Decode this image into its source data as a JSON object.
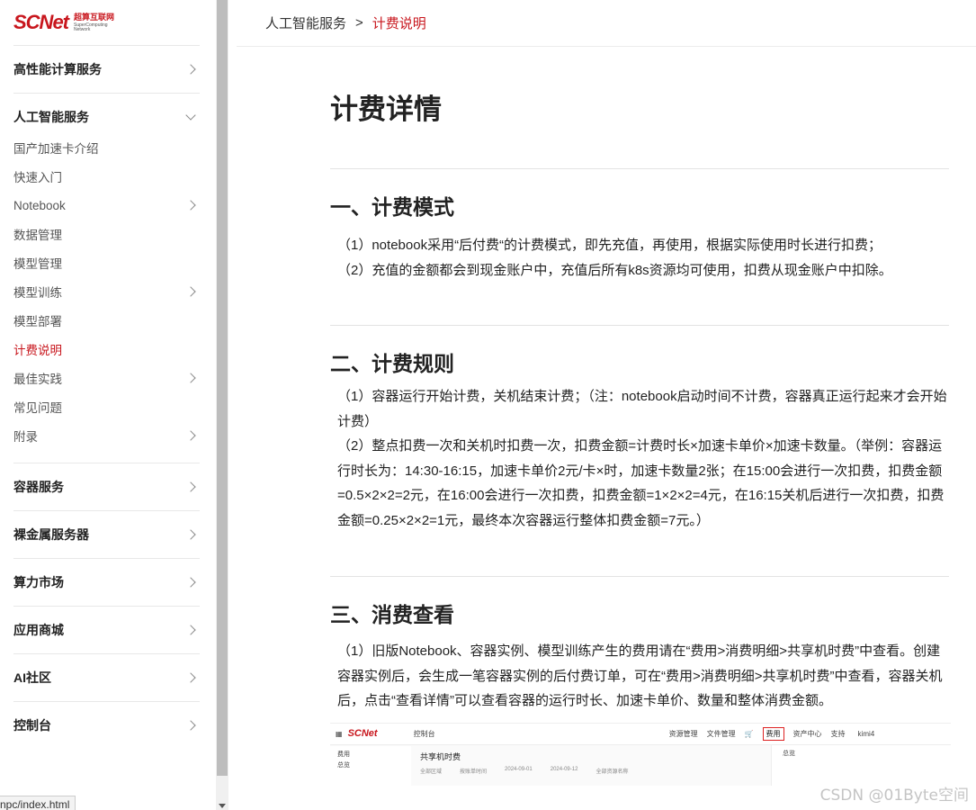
{
  "sidebar": {
    "logo_text": "SCNet",
    "logo_cn": "超算互联网",
    "logo_en_line1": "SuperComputing",
    "logo_en_line2": "Network",
    "sections": [
      {
        "label": "高性能计算服务",
        "expanded": false
      },
      {
        "label": "人工智能服务",
        "expanded": true
      },
      {
        "label": "容器服务",
        "expanded": false
      },
      {
        "label": "裸金属服务器",
        "expanded": false
      },
      {
        "label": "算力市场",
        "expanded": false
      },
      {
        "label": "应用商城",
        "expanded": false
      },
      {
        "label": "AI社区",
        "expanded": false
      },
      {
        "label": "控制台",
        "expanded": false
      }
    ],
    "ai_items": [
      {
        "label": "国产加速卡介绍",
        "has_children": false
      },
      {
        "label": "快速入门",
        "has_children": false
      },
      {
        "label": "Notebook",
        "has_children": true
      },
      {
        "label": "数据管理",
        "has_children": false
      },
      {
        "label": "模型管理",
        "has_children": false
      },
      {
        "label": "模型训练",
        "has_children": true
      },
      {
        "label": "模型部署",
        "has_children": false
      },
      {
        "label": "计费说明",
        "has_children": false,
        "active": true
      },
      {
        "label": "最佳实践",
        "has_children": true
      },
      {
        "label": "常见问题",
        "has_children": false
      },
      {
        "label": "附录",
        "has_children": true
      }
    ]
  },
  "status_url": "npc/index.html",
  "breadcrumb": {
    "parent": "人工智能服务",
    "separator": ">",
    "current": "计费说明"
  },
  "article": {
    "title": "计费详情",
    "sections": [
      {
        "heading": "一、计费模式",
        "paragraphs": [
          "（1）notebook采用“后付费“的计费模式，即先充值，再使用，根据实际使用时长进行扣费；",
          "（2）充值的金额都会到现金账户中，充值后所有k8s资源均可使用，扣费从现金账户中扣除。"
        ]
      },
      {
        "heading": "二、计费规则",
        "paragraphs": [
          "（1）容器运行开始计费，关机结束计费；（注：notebook启动时间不计费，容器真正运行起来才会开始计费）",
          "（2）整点扣费一次和关机时扣费一次，扣费金额=计费时长×加速卡单价×加速卡数量。（举例：容器运行时长为：14:30-16:15，加速卡单价2元/卡×时，加速卡数量2张；在15:00会进行一次扣费，扣费金额=0.5×2×2=2元，在16:00会进行一次扣费，扣费金额=1×2×2=4元，在16:15关机后进行一次扣费，扣费金额=0.25×2×2=1元，最终本次容器运行整体扣费金额=7元。）"
        ]
      },
      {
        "heading": "三、消费查看",
        "paragraphs": [
          "（1）旧版Notebook、容器实例、模型训练产生的费用请在“费用>消费明细>共享机时费”中查看。创建容器实例后，会生成一笔容器实例的后付费订单，可在“费用>消费明细>共享机时费”中查看，容器关机后，点击“查看详情”可以查看容器的运行时长、加速卡单价、数量和整体消费金额。"
        ]
      }
    ]
  },
  "embedded_screenshot": {
    "logo": "SCNet",
    "console": "控制台",
    "nav": [
      "资源管理",
      "文件管理",
      "费用",
      "资产中心",
      "支持"
    ],
    "highlighted": "费用",
    "user": "kimi4",
    "left_title": "费用",
    "left_item": "总览",
    "main_title": "共享机时费",
    "filters": [
      "全部区域",
      "按账单时间",
      "2024-09-01",
      "2024-09-12",
      "全部资源名称"
    ],
    "popup_item": "总览"
  },
  "watermark": "CSDN @01Byte空间"
}
